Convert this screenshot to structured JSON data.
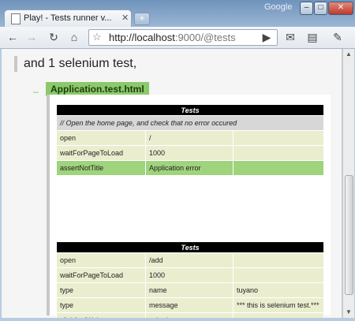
{
  "browser": {
    "brand": "Google",
    "tab_title": "Play! - Tests runner v...",
    "url_host": "http://localhost",
    "url_rest": ":9000/@tests"
  },
  "page": {
    "heading": "and 1 selenium test,",
    "file": "Application.test.html",
    "table1": {
      "title": "Tests",
      "comment": "// Open the home page, and check that no error occured",
      "rows": [
        {
          "cmd": "open",
          "target": "/",
          "value": "",
          "status": "plain"
        },
        {
          "cmd": "waitForPageToLoad",
          "target": "1000",
          "value": "",
          "status": "plain"
        },
        {
          "cmd": "assertNotTitle",
          "target": "Application error",
          "value": "",
          "status": "pass"
        }
      ]
    },
    "table2": {
      "title": "Tests",
      "rows": [
        {
          "cmd": "open",
          "target": "/add",
          "value": ""
        },
        {
          "cmd": "waitForPageToLoad",
          "target": "1000",
          "value": ""
        },
        {
          "cmd": "type",
          "target": "name",
          "value": "tuyano"
        },
        {
          "cmd": "type",
          "target": "message",
          "value": "*** this is selenium test.***"
        },
        {
          "cmd": "clickAndWait",
          "target": "submit",
          "value": ""
        }
      ]
    }
  }
}
